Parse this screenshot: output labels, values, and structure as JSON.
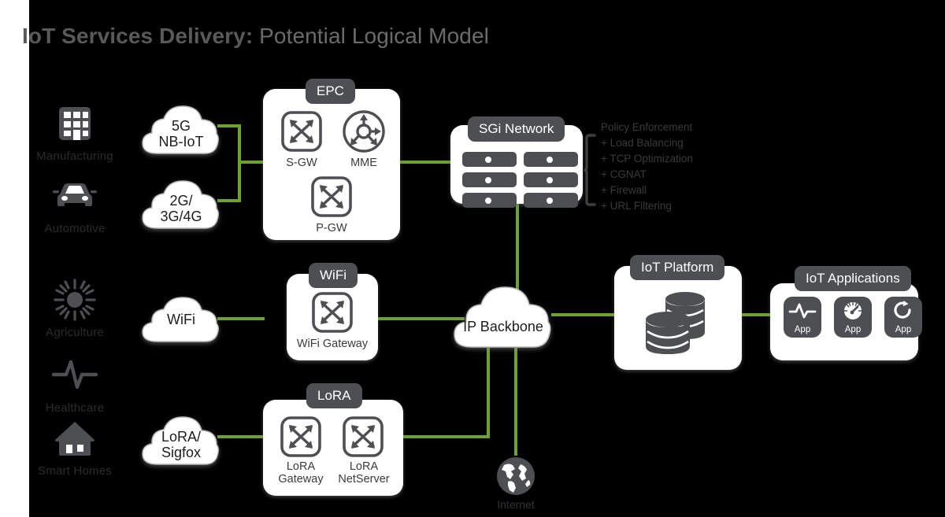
{
  "title": {
    "bold": "IoT Services Delivery:",
    "light": " Potential Logical Model"
  },
  "colors": {
    "green_link": "#6ba231",
    "dark_gray": "#4d4f53",
    "background": "#000000",
    "node_bg": "#ffffff"
  },
  "verticals": [
    {
      "label": "Manufacturing",
      "icon": "factory-icon"
    },
    {
      "label": "Automotive",
      "icon": "car-icon"
    },
    {
      "label": "Agriculture",
      "icon": "sun-icon"
    },
    {
      "label": "Healthcare",
      "icon": "pulse-icon"
    },
    {
      "label": "Smart Homes",
      "icon": "house-icon"
    }
  ],
  "access_clouds": [
    {
      "label": "5G\nNB-IoT",
      "name": "cloud-5g-nbiot"
    },
    {
      "label": "2G/\n3G/4G",
      "name": "cloud-2g-3g-4g"
    },
    {
      "label": "WiFi",
      "name": "cloud-wifi"
    },
    {
      "label": "LoRA/\nSigfox",
      "name": "cloud-lora-sigfox"
    }
  ],
  "epc": {
    "tag": "EPC",
    "elements": [
      {
        "label": "S-GW",
        "icon": "switch-icon"
      },
      {
        "label": "MME",
        "icon": "mme-router-circle-icon"
      },
      {
        "label": "P-GW",
        "icon": "switch-icon"
      }
    ]
  },
  "sgi": {
    "tag": "SGi Network",
    "server_count": 6,
    "policy": {
      "header": "Policy Enforcement",
      "items": [
        "+ Load Balancing",
        "+ TCP Optimization",
        "+ CGNAT",
        "+ Firewall",
        "+ URL Filtering"
      ]
    }
  },
  "wifi": {
    "tag": "WiFi",
    "elements": [
      {
        "label": "WiFi Gateway",
        "icon": "switch-icon"
      }
    ]
  },
  "lora": {
    "tag": "LoRA",
    "elements": [
      {
        "label": "LoRA\nGateway",
        "icon": "switch-icon"
      },
      {
        "label": "LoRA\nNetServer",
        "icon": "switch-icon"
      }
    ]
  },
  "backbone": {
    "label": "IP Backbone",
    "name": "cloud-ip-backbone"
  },
  "platform": {
    "tag": "IoT Platform",
    "icon": "database-stack-icon"
  },
  "applications": {
    "tag": "IoT Applications",
    "apps": [
      {
        "label": "App",
        "icon": "pulse-icon"
      },
      {
        "label": "App",
        "icon": "gauge-icon"
      },
      {
        "label": "App",
        "icon": "refresh-icon"
      }
    ]
  },
  "internet": {
    "label": "Internet",
    "icon": "globe-icon"
  }
}
